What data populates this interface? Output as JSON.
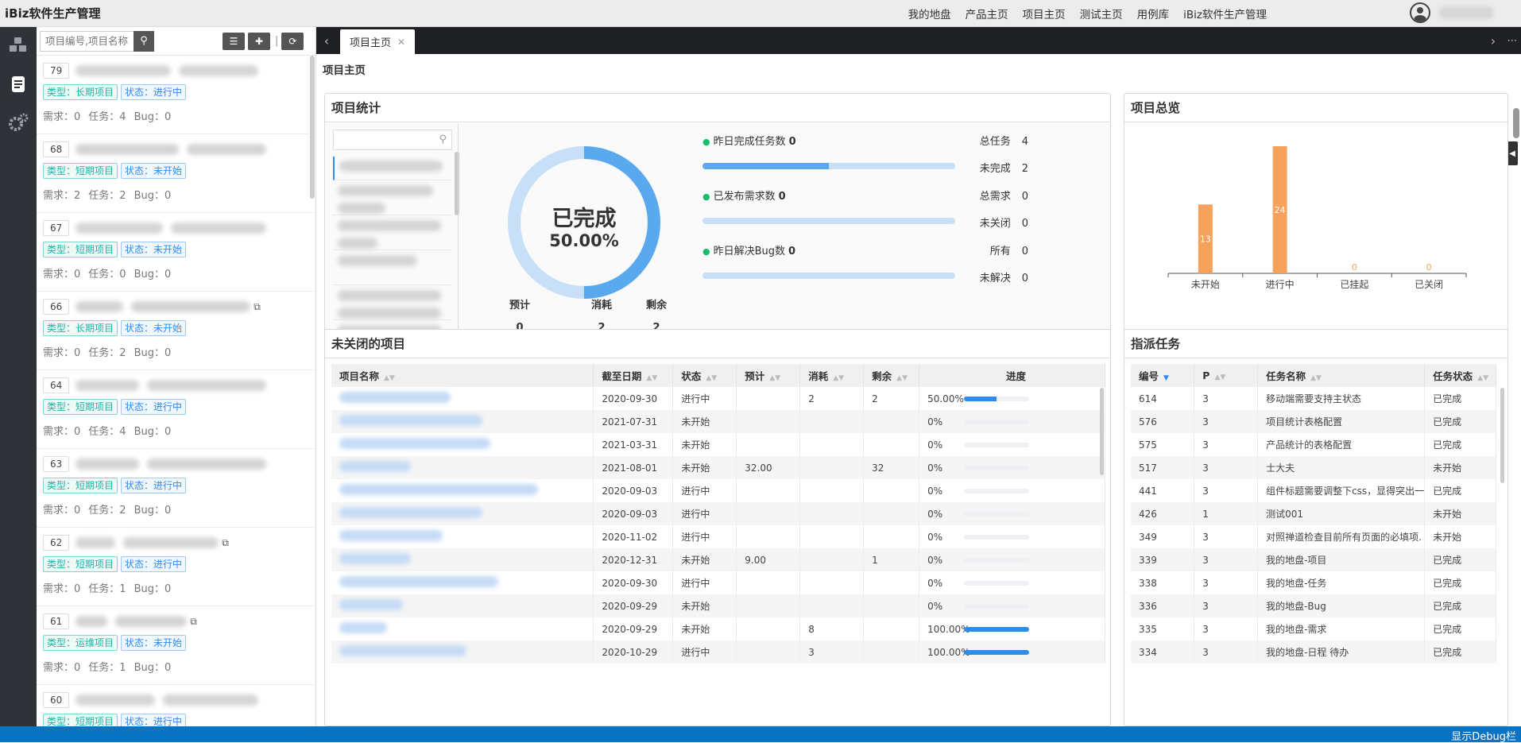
{
  "app_title": "iBiz软件生产管理",
  "top_nav": [
    "我的地盘",
    "产品主页",
    "项目主页",
    "测试主页",
    "用例库",
    "iBiz软件生产管理"
  ],
  "left_nav_icons": [
    "cubes-icon",
    "list-icon",
    "gears-icon"
  ],
  "list_toolbar": {
    "search_placeholder": "项目编号,项目名称"
  },
  "projects": [
    {
      "num": "79",
      "type": "类型：长期项目",
      "status": "状态：进行中",
      "req": "需求：0",
      "task": "任务：4",
      "bug": "Bug：0"
    },
    {
      "num": "68",
      "type": "类型：短期项目",
      "status": "状态：未开始",
      "req": "需求：2",
      "task": "任务：2",
      "bug": "Bug：0"
    },
    {
      "num": "67",
      "type": "类型：短期项目",
      "status": "状态：未开始",
      "req": "需求：0",
      "task": "任务：0",
      "bug": "Bug：0"
    },
    {
      "num": "66",
      "type": "类型：长期项目",
      "status": "状态：未开始",
      "req": "需求：0",
      "task": "任务：2",
      "bug": "Bug：0"
    },
    {
      "num": "64",
      "type": "类型：短期项目",
      "status": "状态：进行中",
      "req": "需求：0",
      "task": "任务：4",
      "bug": "Bug：0"
    },
    {
      "num": "63",
      "type": "类型：短期项目",
      "status": "状态：进行中",
      "req": "需求：0",
      "task": "任务：2",
      "bug": "Bug：0"
    },
    {
      "num": "62",
      "type": "类型：短期项目",
      "status": "状态：进行中",
      "req": "需求：0",
      "task": "任务：1",
      "bug": "Bug：0"
    },
    {
      "num": "61",
      "type": "类型：运维项目",
      "status": "状态：未开始",
      "req": "需求：0",
      "task": "任务：1",
      "bug": "Bug：0"
    },
    {
      "num": "60",
      "type": "类型：短期项目",
      "status": "状态：进行中",
      "req": "",
      "task": "",
      "bug": ""
    }
  ],
  "tab": {
    "label": "项目主页"
  },
  "page_title": "项目主页",
  "stats_panel": {
    "title": "项目统计",
    "donut_label": "已完成",
    "donut_percent": "50.00%",
    "donut_value": 0.5,
    "estimate_label": "预计",
    "estimate": "0",
    "consumed_label": "消耗",
    "consumed": "2",
    "left_label": "剩余",
    "left": "2",
    "rows": [
      {
        "label": "昨日完成任务数",
        "value": "0",
        "bar": 0.5,
        "r1_label": "总任务",
        "r1": "4",
        "r2_label": "未完成",
        "r2": "2"
      },
      {
        "label": "已发布需求数",
        "value": "0",
        "bar": 0,
        "r1_label": "总需求",
        "r1": "0",
        "r2_label": "未关闭",
        "r2": "0"
      },
      {
        "label": "昨日解决Bug数",
        "value": "0",
        "bar": 0,
        "r1_label": "所有",
        "r1": "0",
        "r2_label": "未解决",
        "r2": "0"
      }
    ]
  },
  "overview_panel": {
    "title": "项目总览"
  },
  "chart_data": {
    "type": "bar",
    "categories": [
      "未开始",
      "进行中",
      "已挂起",
      "已关闭"
    ],
    "values": [
      13,
      24,
      0,
      0
    ],
    "color": "#f5a35c"
  },
  "open_projects": {
    "title": "未关闭的项目",
    "headers": [
      "项目名称",
      "截至日期",
      "状态",
      "预计",
      "消耗",
      "剩余",
      "进度"
    ],
    "rows": [
      {
        "end": "2020-09-30",
        "status": "进行中",
        "est": "",
        "used": "2",
        "left": "2",
        "pct": "50.00%",
        "p": 0.5
      },
      {
        "end": "2021-07-31",
        "status": "未开始",
        "est": "",
        "used": "",
        "left": "",
        "pct": "0%",
        "p": 0
      },
      {
        "end": "2021-03-31",
        "status": "未开始",
        "est": "",
        "used": "",
        "left": "",
        "pct": "0%",
        "p": 0
      },
      {
        "end": "2021-08-01",
        "status": "未开始",
        "est": "32.00",
        "used": "",
        "left": "32",
        "pct": "0%",
        "p": 0
      },
      {
        "end": "2020-09-03",
        "status": "进行中",
        "est": "",
        "used": "",
        "left": "",
        "pct": "0%",
        "p": 0
      },
      {
        "end": "2020-09-03",
        "status": "进行中",
        "est": "",
        "used": "",
        "left": "",
        "pct": "0%",
        "p": 0
      },
      {
        "end": "2020-11-02",
        "status": "进行中",
        "est": "",
        "used": "",
        "left": "",
        "pct": "0%",
        "p": 0
      },
      {
        "end": "2020-12-31",
        "status": "未开始",
        "est": "9.00",
        "used": "",
        "left": "1",
        "pct": "0%",
        "p": 0
      },
      {
        "end": "2020-09-30",
        "status": "进行中",
        "est": "",
        "used": "",
        "left": "",
        "pct": "0%",
        "p": 0
      },
      {
        "end": "2020-09-29",
        "status": "未开始",
        "est": "",
        "used": "",
        "left": "",
        "pct": "0%",
        "p": 0
      },
      {
        "end": "2020-09-29",
        "status": "未开始",
        "est": "",
        "used": "8",
        "left": "",
        "pct": "100.00%",
        "p": 1
      },
      {
        "end": "2020-10-29",
        "status": "进行中",
        "est": "",
        "used": "3",
        "left": "",
        "pct": "100.00%",
        "p": 1
      }
    ]
  },
  "tasks": {
    "title": "指派任务",
    "headers": [
      "编号",
      "P",
      "任务名称",
      "任务状态"
    ],
    "rows": [
      {
        "id": "614",
        "p": "3",
        "name": "移动端需要支持主状态",
        "status": "已完成"
      },
      {
        "id": "576",
        "p": "3",
        "name": "项目统计表格配置",
        "status": "已完成"
      },
      {
        "id": "575",
        "p": "3",
        "name": "产品统计的表格配置",
        "status": "已完成"
      },
      {
        "id": "517",
        "p": "3",
        "name": "士大夫",
        "status": "未开始"
      },
      {
        "id": "441",
        "p": "3",
        "name": "组件标题需要调整下css，显得突出一",
        "status": "已完成"
      },
      {
        "id": "426",
        "p": "1",
        "name": "测试001",
        "status": "未开始"
      },
      {
        "id": "349",
        "p": "3",
        "name": "对照禅道检查目前所有页面的必填项.",
        "status": "未开始"
      },
      {
        "id": "339",
        "p": "3",
        "name": "我的地盘-项目",
        "status": "已完成"
      },
      {
        "id": "338",
        "p": "3",
        "name": "我的地盘-任务",
        "status": "已完成"
      },
      {
        "id": "336",
        "p": "3",
        "name": "我的地盘-Bug",
        "status": "已完成"
      },
      {
        "id": "335",
        "p": "3",
        "name": "我的地盘-需求",
        "status": "已完成"
      },
      {
        "id": "334",
        "p": "3",
        "name": "我的地盘-日程 待办",
        "status": "已完成"
      }
    ]
  },
  "footer": {
    "label": "显示Debug栏"
  }
}
